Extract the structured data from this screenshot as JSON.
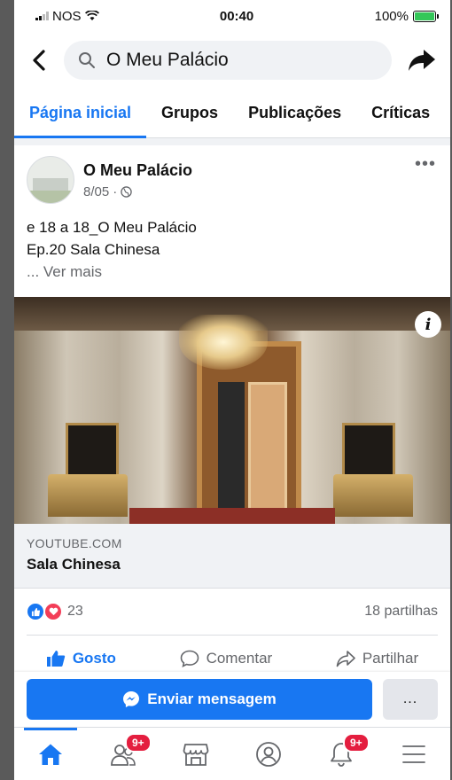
{
  "status_bar": {
    "carrier": "NOS",
    "time": "00:40",
    "battery_percent": "100%",
    "battery_level": 1.0
  },
  "header": {
    "search_value": "O Meu Palácio"
  },
  "tabs": [
    {
      "label": "Página inicial",
      "active": true
    },
    {
      "label": "Grupos"
    },
    {
      "label": "Publicações"
    },
    {
      "label": "Críticas"
    }
  ],
  "post": {
    "page_name": "O Meu Palácio",
    "date": "8/05",
    "text_line1": "e 18 a 18_O Meu Palácio",
    "text_line2": "Ep.20 Sala Chinesa",
    "see_more": "... Ver mais",
    "link": {
      "domain": "YOUTUBE.COM",
      "title": "Sala Chinesa"
    },
    "reaction_count": "23",
    "shares": "18 partilhas",
    "actions": {
      "like": "Gosto",
      "comment": "Comentar",
      "share": "Partilhar"
    }
  },
  "message_bar": {
    "send_label": "Enviar mensagem",
    "more_label": "..."
  },
  "bottom_nav": {
    "friends_badge": "9+",
    "notifications_badge": "9+"
  },
  "colors": {
    "accent": "#1877f2",
    "badge": "#e41e3f",
    "love": "#f33e58"
  }
}
